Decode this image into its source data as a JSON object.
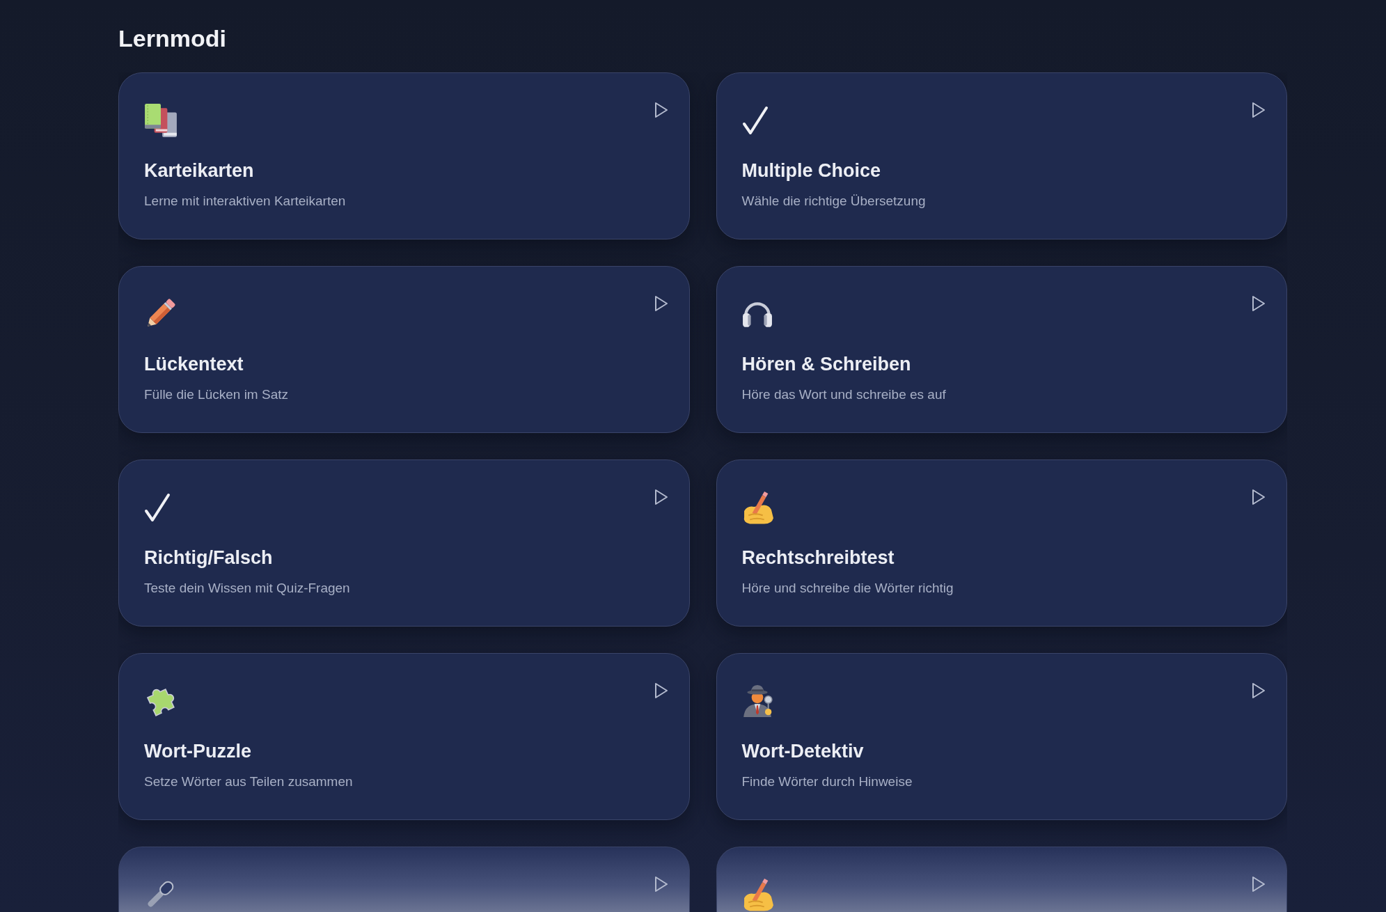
{
  "heading": "Lernmodi",
  "modes": [
    {
      "kind": "books",
      "title": "Karteikarten",
      "description": "Lerne mit interaktiven Karteikarten",
      "faded": false
    },
    {
      "kind": "check",
      "title": "Multiple Choice",
      "description": "Wähle die richtige Übersetzung",
      "faded": false
    },
    {
      "kind": "pencil",
      "title": "Lückentext",
      "description": "Fülle die Lücken im Satz",
      "faded": false
    },
    {
      "kind": "headphones",
      "title": "Hören & Schreiben",
      "description": "Höre das Wort und schreibe es auf",
      "faded": false
    },
    {
      "kind": "check",
      "title": "Richtig/Falsch",
      "description": "Teste dein Wissen mit Quiz-Fragen",
      "faded": false
    },
    {
      "kind": "writing",
      "title": "Rechtschreibtest",
      "description": "Höre und schreibe die Wörter richtig",
      "faded": false
    },
    {
      "kind": "puzzle",
      "title": "Wort-Puzzle",
      "description": "Setze Wörter aus Teilen zusammen",
      "faded": false
    },
    {
      "kind": "detective",
      "title": "Wort-Detektiv",
      "description": "Finde Wörter durch Hinweise",
      "faded": false
    },
    {
      "kind": "microphone",
      "faded": true
    },
    {
      "kind": "writing",
      "faded": true
    }
  ]
}
